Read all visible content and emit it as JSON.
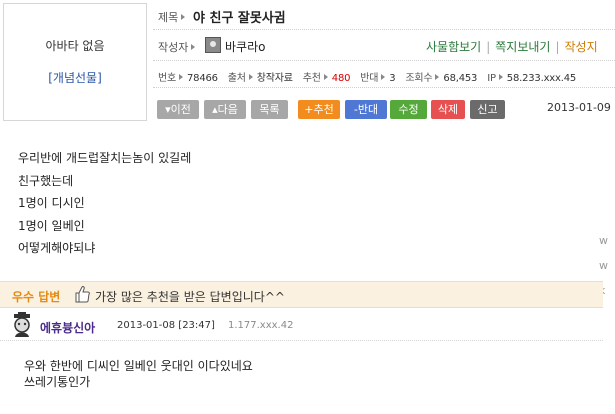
{
  "profile": {
    "no_avatar_text": "아바타 없음",
    "gift_link": "[개념선물]"
  },
  "post": {
    "title_label": "제목",
    "title": "야 친구 잘못사귐",
    "author_label": "작성자",
    "author_name": "바쿠라o",
    "links": [
      "사물함보기",
      "쪽지보내기",
      "작성지"
    ],
    "meta": {
      "number_label": "번호",
      "number": "78466",
      "source_label": "출처",
      "source": "창작자료",
      "recommend_label": "추천",
      "recommend": "480",
      "oppose_label": "반대",
      "oppose": "3",
      "views_label": "조회수",
      "views": "68,453",
      "ip_label": "IP",
      "ip": "58.233.xxx.45"
    },
    "buttons": [
      "이전",
      "다음",
      "목록",
      "추천",
      "반대",
      "수정",
      "삭제",
      "신고"
    ],
    "date": "2013-01-09",
    "body_lines": [
      "우리반에 개드럽잘치는놈이 있길레",
      "친구했는데",
      "1명이 디시인",
      "1명이 일베인",
      "어떻게해야되냐"
    ],
    "side_fragments": [
      "w",
      "w",
      "k"
    ]
  },
  "best_answer": {
    "label": "우수 답변",
    "message": "가장 많은 추천을 받은 답변입니다^^"
  },
  "comment": {
    "author": "에휴븅신아",
    "date": "2013-01-08 [23:47]",
    "ip": "1.177.xxx.42",
    "lines": [
      "우와 한반에 디씨인 일베인 웃대인 이다있네요",
      "쓰레기통인가"
    ]
  },
  "colors": {
    "accent_orange": "#f28c1e",
    "accent_blue": "#4f78d4",
    "accent_green": "#55a83a",
    "accent_red": "#e65050",
    "best_bg": "#fbf1e0"
  }
}
